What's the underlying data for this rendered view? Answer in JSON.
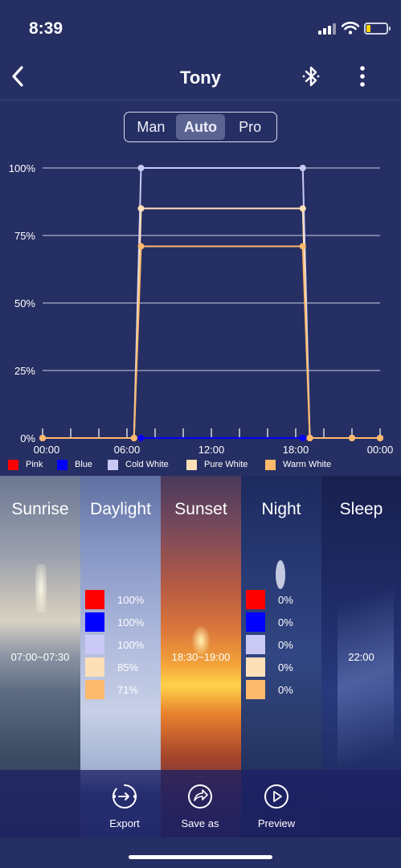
{
  "status_bar": {
    "time": "8:39"
  },
  "nav": {
    "title": "Tony"
  },
  "mode_tabs": [
    {
      "label": "Man",
      "active": false
    },
    {
      "label": "Auto",
      "active": true
    },
    {
      "label": "Pro",
      "active": false
    }
  ],
  "colors": {
    "background": "#262f63",
    "pink": "#ff0000",
    "blue": "#0000ff",
    "cold_white": "#c8c9f5",
    "pure_white": "#fde0b8",
    "warm_white": "#fdb96c"
  },
  "chart_data": {
    "type": "line",
    "x_ticks": [
      "00:00",
      "06:00",
      "12:00",
      "18:00",
      "00:00"
    ],
    "y_ticks": [
      "0%",
      "25%",
      "50%",
      "75%",
      "100%"
    ],
    "xlim": [
      0,
      24
    ],
    "ylim": [
      0,
      100
    ],
    "x_unit": "hours",
    "grid": true,
    "legend_position": "bottom",
    "series": [
      {
        "name": "Pink",
        "color": "#ff0000",
        "points": [
          [
            0,
            0
          ],
          [
            6.5,
            0
          ],
          [
            7,
            0
          ],
          [
            18.5,
            0
          ],
          [
            19,
            0
          ],
          [
            22,
            0
          ],
          [
            24,
            0
          ]
        ]
      },
      {
        "name": "Blue",
        "color": "#0000ff",
        "points": [
          [
            0,
            0
          ],
          [
            6.5,
            0
          ],
          [
            7,
            0
          ],
          [
            18.5,
            0
          ],
          [
            19,
            0
          ],
          [
            22,
            0
          ],
          [
            24,
            0
          ]
        ]
      },
      {
        "name": "Cold White",
        "color": "#c8c9f5",
        "points": [
          [
            0,
            0
          ],
          [
            6.5,
            0
          ],
          [
            7,
            100
          ],
          [
            18.5,
            100
          ],
          [
            19,
            0
          ],
          [
            22,
            0
          ],
          [
            24,
            0
          ]
        ]
      },
      {
        "name": "Pure White",
        "color": "#fde0b8",
        "points": [
          [
            0,
            0
          ],
          [
            6.5,
            0
          ],
          [
            7,
            85
          ],
          [
            18.5,
            85
          ],
          [
            19,
            0
          ],
          [
            22,
            0
          ],
          [
            24,
            0
          ]
        ]
      },
      {
        "name": "Warm White",
        "color": "#fdb96c",
        "points": [
          [
            0,
            0
          ],
          [
            6.5,
            0
          ],
          [
            7,
            71
          ],
          [
            18.5,
            71
          ],
          [
            19,
            0
          ],
          [
            22,
            0
          ],
          [
            24,
            0
          ]
        ]
      }
    ]
  },
  "scenes": [
    {
      "name": "Sunrise",
      "time": "07:00~07:30"
    },
    {
      "name": "Daylight",
      "levels": [
        "100%",
        "100%",
        "100%",
        "85%",
        "71%"
      ]
    },
    {
      "name": "Sunset",
      "time": "18:30~19:00"
    },
    {
      "name": "Night",
      "levels": [
        "0%",
        "0%",
        "0%",
        "0%",
        "0%"
      ]
    },
    {
      "name": "Sleep",
      "time": "22:00"
    }
  ],
  "actions": [
    {
      "label": "Export",
      "icon": "export-icon"
    },
    {
      "label": "Save as",
      "icon": "share-arrow-icon"
    },
    {
      "label": "Preview",
      "icon": "play-icon"
    }
  ]
}
